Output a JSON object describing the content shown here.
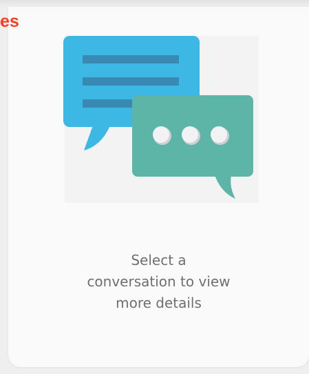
{
  "header": {
    "title_fragment": "es"
  },
  "empty_state": {
    "message_lines": [
      "Select a",
      "conversation to view",
      "more details"
    ],
    "illustration_icon": "chat-bubbles-icon"
  },
  "colors": {
    "accent_red": "#ff3b1f",
    "bubble_blue": "#3db8e4",
    "bubble_blue_lines": "#3a88b4",
    "bubble_teal": "#5db5a8",
    "dots": "#f2f2f4",
    "text_gray": "#6f6f6f"
  }
}
